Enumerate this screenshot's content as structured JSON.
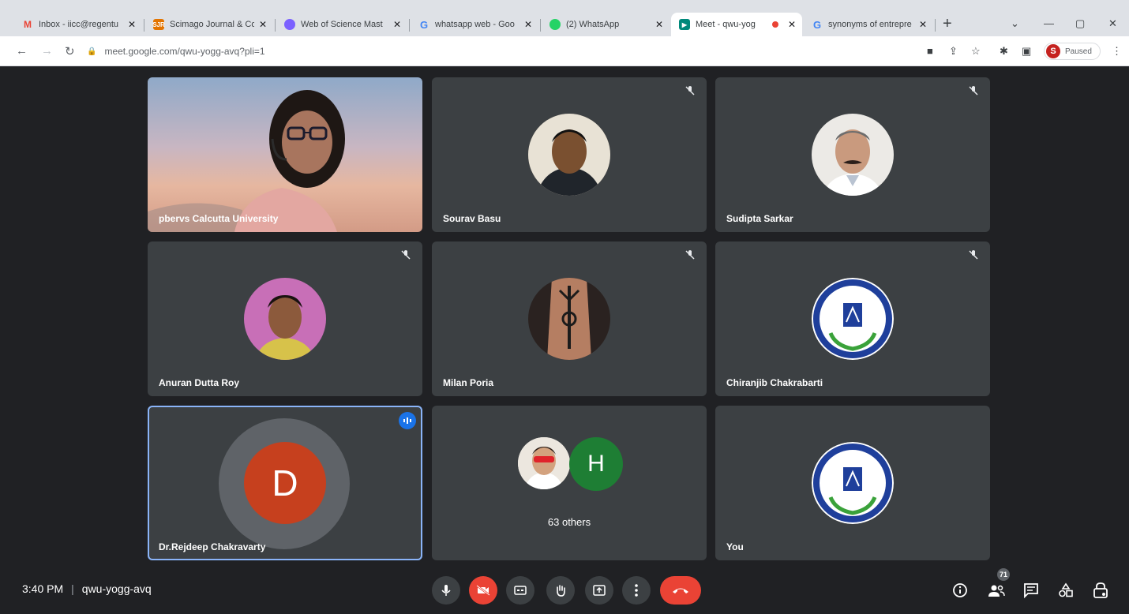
{
  "browser": {
    "tabs": [
      {
        "title": "Inbox - iicc@regentu",
        "favicon": "gmail-icon",
        "color": "#ea4335"
      },
      {
        "title": "Scimago Journal & Co",
        "favicon": "scimago-icon",
        "color": "#e37400"
      },
      {
        "title": "Web of Science Mast",
        "favicon": "wos-icon",
        "color": "#7b61ff"
      },
      {
        "title": "whatsapp web - Goo",
        "favicon": "google-icon",
        "color": "#4285f4"
      },
      {
        "title": "(2) WhatsApp",
        "favicon": "whatsapp-icon",
        "color": "#25d366"
      },
      {
        "title": "Meet - qwu-yog",
        "favicon": "meet-icon",
        "color": "#00897b",
        "active": true
      },
      {
        "title": "synonyms of entrepre",
        "favicon": "google-icon",
        "color": "#4285f4"
      }
    ],
    "url": "meet.google.com/qwu-yogg-avq?pli=1",
    "profile": {
      "initial": "S",
      "status": "Paused"
    }
  },
  "participants": [
    {
      "name": "pbervs Calcutta University",
      "type": "video",
      "muted": false
    },
    {
      "name": "Sourav Basu",
      "type": "photo",
      "muted": true,
      "photo_bg": "#7a6a55"
    },
    {
      "name": "Sudipta Sarkar",
      "type": "photo",
      "muted": true,
      "photo_bg": "#d9d6d0"
    },
    {
      "name": "Anuran Dutta Roy",
      "type": "photo",
      "muted": true,
      "photo_bg": "#c86fb7"
    },
    {
      "name": "Milan Poria",
      "type": "photo",
      "muted": true,
      "photo_bg": "#8c6a55"
    },
    {
      "name": "Chiranjib Chakrabarti",
      "type": "logo",
      "muted": true
    },
    {
      "name": "Dr.Rejdeep Chakravarty",
      "type": "initial",
      "initial": "D",
      "speaking": true
    },
    {
      "name": "63 others",
      "type": "others",
      "initial": "H"
    },
    {
      "name": "You",
      "type": "logo",
      "muted": false
    }
  ],
  "meeting": {
    "time": "3:40 PM",
    "code": "qwu-yogg-avq",
    "people_count": "71"
  },
  "colors": {
    "background": "#202124",
    "tile": "#3c4043",
    "danger": "#ea4335",
    "initial_bg": "#c6401e",
    "others_bg": "#1e7e34",
    "speaking_outline": "#8ab4f8"
  }
}
